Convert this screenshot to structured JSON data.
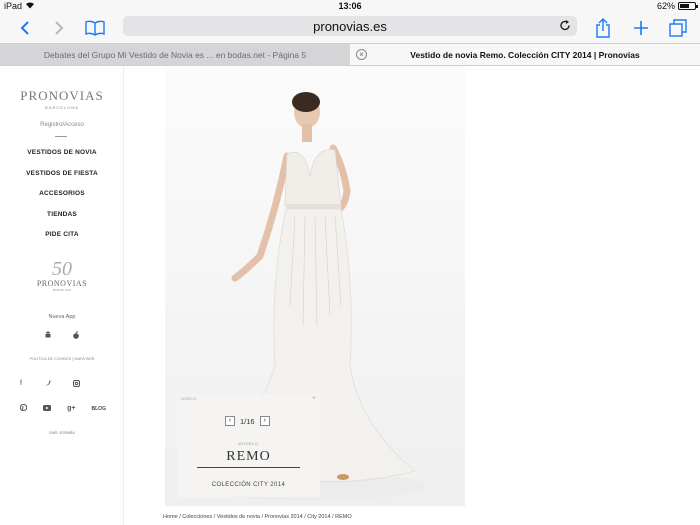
{
  "status_bar": {
    "device": "iPad",
    "time": "13:06",
    "battery": "62%",
    "battery_level": 0.62
  },
  "toolbar": {
    "address": "pronovias.es"
  },
  "tabs": [
    {
      "title": "Debates del Grupo Mi Vestido de Novia es ... en bodas.net - Página 5"
    },
    {
      "title": "Vestido de novia Remo. Colección CITY 2014 | Pronovias"
    }
  ],
  "sidebar": {
    "logo": "PRONOVIAS",
    "logo_sub": "BARCELONA",
    "register": "Registro/Acceso",
    "menu": [
      "VESTIDOS DE NOVIA",
      "VESTIDOS DE FIESTA",
      "ACCESORIOS",
      "TIENDAS",
      "PIDE CITA"
    ],
    "anniversary_number": "50",
    "anniversary_brand": "PRONOVIAS",
    "anniversary_sub": "BARCELONA",
    "app": "Nueva App",
    "policy": "POLÍTICA DE COOKIES  |  MAPA WEB",
    "blog": "BLOG",
    "country": "PAÍS: ESPAÑA"
  },
  "product": {
    "corner_label": "MODELO",
    "pager": "1/16",
    "model_label": "MODELO",
    "name": "REMO",
    "collection": "COLECCIÓN CITY 2014"
  },
  "breadcrumbs": "Home / Colecciones / Vestidos de novia / Pronovias 2014 / City 2014 / REMO"
}
